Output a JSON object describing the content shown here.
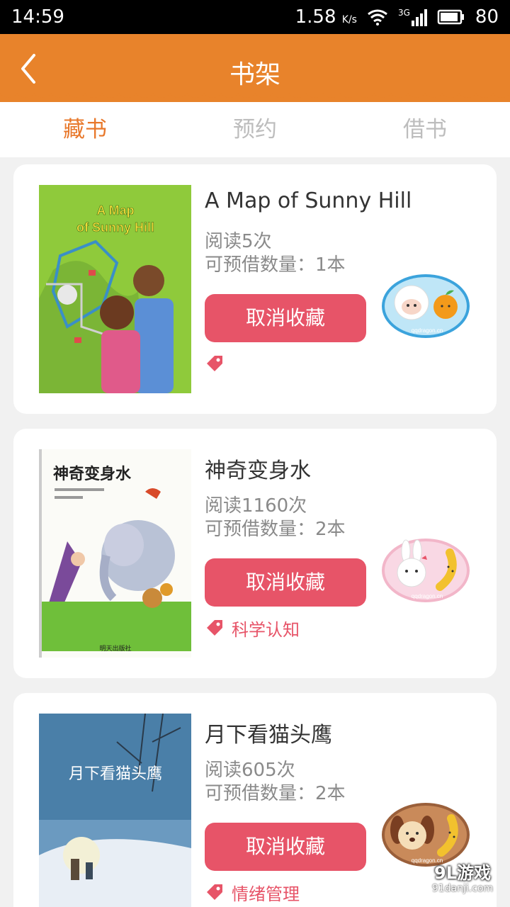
{
  "status_bar": {
    "time": "14:59",
    "speed": "1.58",
    "speed_unit": "K/s",
    "network": "3G",
    "battery": "80"
  },
  "header": {
    "title": "书架"
  },
  "tabs": [
    {
      "label": "藏书",
      "active": true
    },
    {
      "label": "预约",
      "active": false
    },
    {
      "label": "借书",
      "active": false
    }
  ],
  "books": [
    {
      "title": "A Map of Sunny Hill",
      "reads": "阅读5次",
      "available": "可预借数量：1本",
      "action": "取消收藏",
      "tag": "",
      "cover_text": "A Map of Sunny Hill",
      "badge_text": "qqdragon.cn"
    },
    {
      "title": "神奇变身水",
      "reads": "阅读1160次",
      "available": "可预借数量：2本",
      "action": "取消收藏",
      "tag": "科学认知",
      "cover_text": "神奇变身水",
      "cover_publisher": "明天出版社",
      "badge_text": "qqdragon.cn"
    },
    {
      "title": "月下看猫头鹰",
      "reads": "阅读605次",
      "available": "可预借数量：2本",
      "action": "取消收藏",
      "tag": "情绪管理",
      "cover_text": "月下看猫头鹰",
      "badge_text": "qqdragon.cn"
    }
  ],
  "watermark": {
    "main": "9L游戏",
    "sub": "91danji.com"
  },
  "colors": {
    "header": "#e8832b",
    "accent_tab": "#e8782b",
    "button": "#e75468",
    "tag": "#e75468"
  }
}
